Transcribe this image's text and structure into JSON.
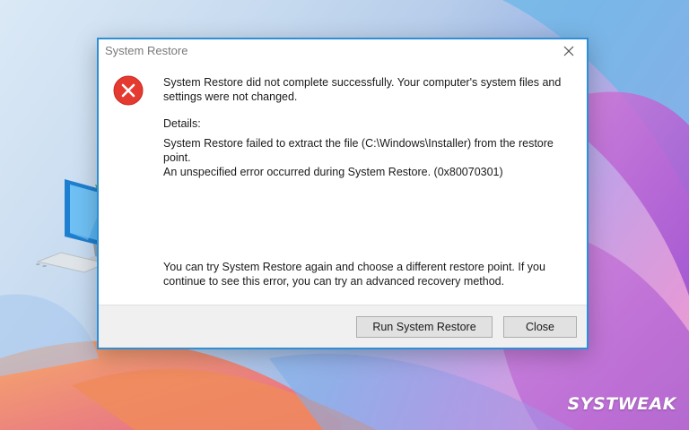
{
  "dialog": {
    "title": "System Restore",
    "main_message": "System Restore did not complete successfully. Your computer's system files and settings were not changed.",
    "details_label": "Details:",
    "details_line1": "System Restore failed to extract the file (C:\\Windows\\Installer) from the restore point.",
    "details_line2": "An unspecified error occurred during System Restore. (0x80070301)",
    "footer_message": "You can try System Restore again and choose a different restore point. If you continue to see this error, you can try an advanced recovery method.",
    "run_button_label": "Run System Restore",
    "close_button_label": "Close"
  },
  "branding": {
    "logo_text": "SYSTWEAK"
  },
  "icons": {
    "error": "error-circle-icon",
    "close": "close-icon",
    "illustration": "computer-restore-clock-icon"
  },
  "colors": {
    "dialog_border": "#2d8fd6",
    "error_red": "#e53a2f",
    "restore_green": "#3fae3a"
  }
}
